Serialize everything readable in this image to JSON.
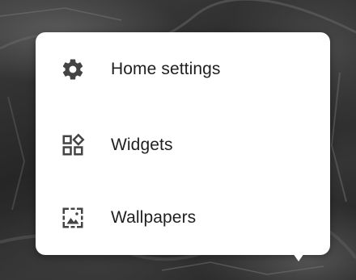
{
  "menu": {
    "items": [
      {
        "label": "Home settings",
        "icon": "gear-icon"
      },
      {
        "label": "Widgets",
        "icon": "widgets-icon"
      },
      {
        "label": "Wallpapers",
        "icon": "wallpaper-icon"
      }
    ]
  },
  "colors": {
    "card_background": "#ffffff",
    "text": "#1f1f1f",
    "icon": "#444444"
  }
}
